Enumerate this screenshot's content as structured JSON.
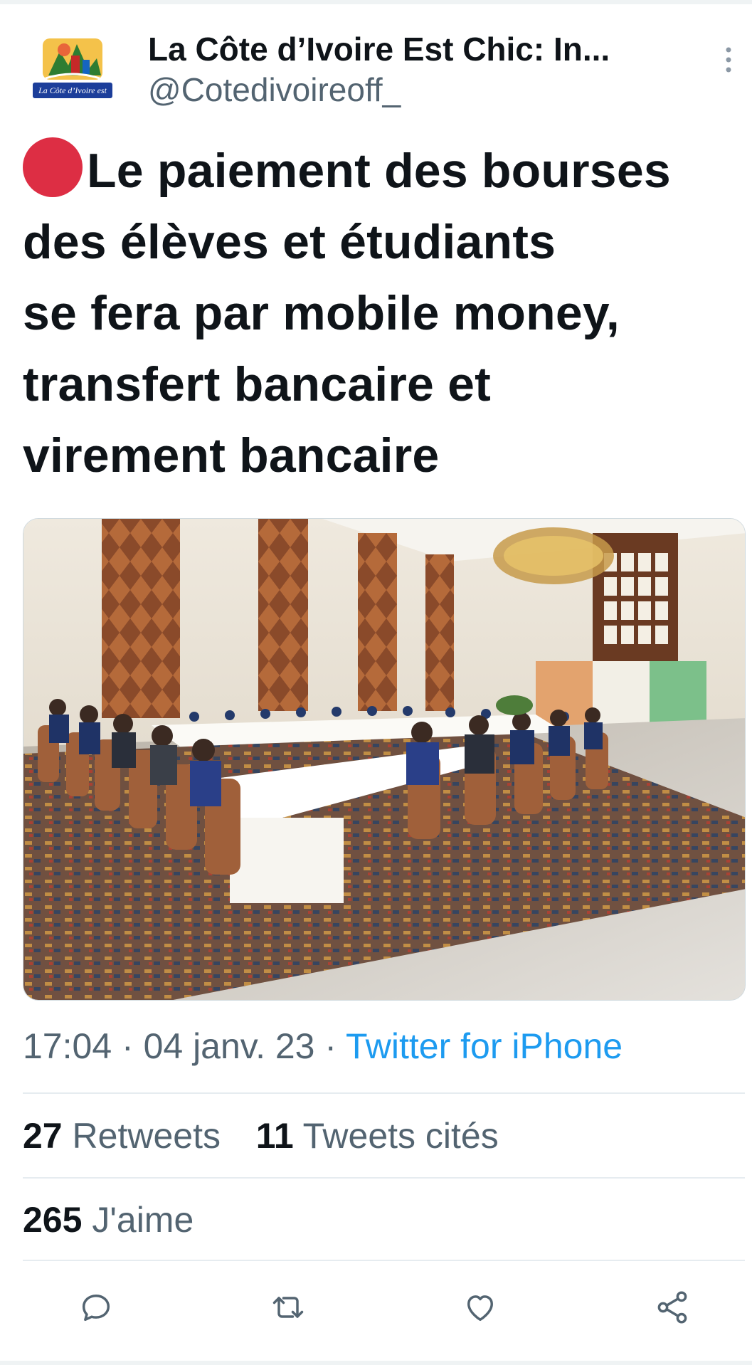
{
  "tweet": {
    "author": {
      "display_name": "La Côte d’Ivoire Est Chic: In...",
      "handle": "@Cotedivoireoff_",
      "avatar_text": "La Côte d’Ivoire est Chic INFOS"
    },
    "text_lines": [
      "Le paiement des bourses",
      "des élèves et étudiants",
      "se fera par mobile money,",
      "transfert bancaire et",
      "virement bancaire"
    ],
    "time": "17:04",
    "date": "04 janv. 23",
    "separator": " · ",
    "source": "Twitter for iPhone",
    "stats": {
      "retweets_count": "27",
      "retweets_label": "Retweets",
      "quotes_count": "11",
      "quotes_label": "Tweets cités",
      "likes_count": "265",
      "likes_label": "J'aime"
    }
  },
  "icons": {
    "more": "more-vertical-icon",
    "reply": "reply-icon",
    "retweet": "retweet-icon",
    "like": "heart-icon",
    "share": "share-icon"
  },
  "colors": {
    "text_primary": "#0f1419",
    "text_secondary": "#536471",
    "link": "#1d9bf0",
    "red_dot": "#dd2e44"
  }
}
